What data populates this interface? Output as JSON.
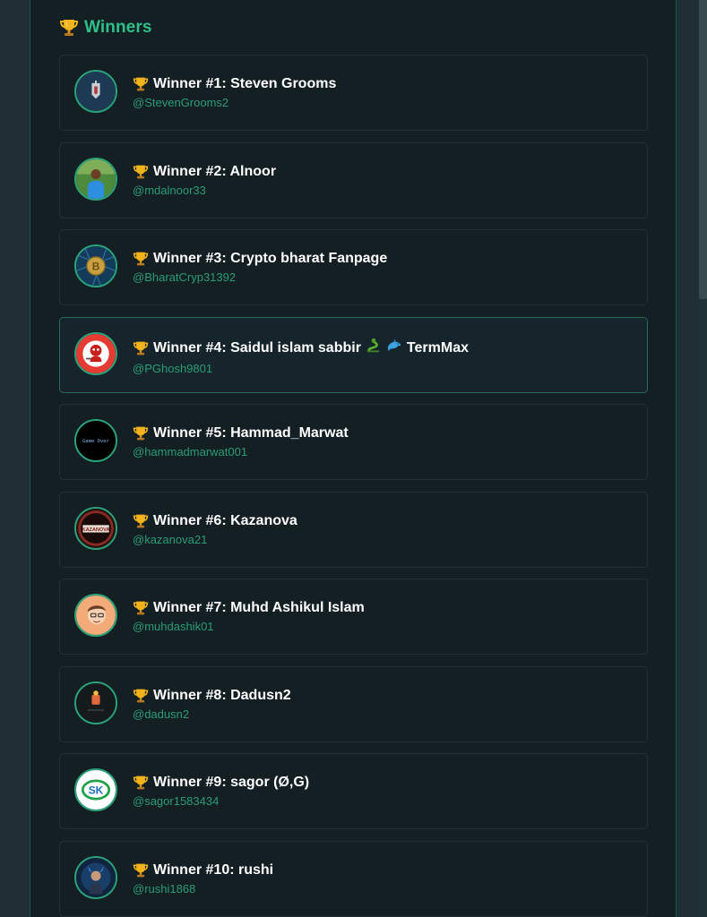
{
  "section": {
    "title": "Winners",
    "icon": "trophy-icon"
  },
  "colors": {
    "accent": "#2fbf88",
    "handle": "#2a9d75",
    "card_bg": "#141f24",
    "card_border": "#223137",
    "highlight_border": "#236b5b"
  },
  "winners": [
    {
      "title": "Winner #1: Steven Grooms",
      "handle": "@StevenGrooms2"
    },
    {
      "title": "Winner #2: Alnoor",
      "handle": "@mdalnoor33"
    },
    {
      "title": "Winner #3: Crypto bharat Fanpage",
      "handle": "@BharatCryp31392"
    },
    {
      "title": "Winner #4: Saidul islam sabbir",
      "title_suffix": "TermMax",
      "handle": "@PGhosh9801",
      "highlighted": true
    },
    {
      "title": "Winner #5: Hammad_Marwat",
      "handle": "@hammadmarwat001",
      "avatar_text": "Game Over"
    },
    {
      "title": "Winner #6: Kazanova",
      "handle": "@kazanova21",
      "avatar_text": "KAZANOVA"
    },
    {
      "title": "Winner #7: Muhd Ashikul Islam",
      "handle": "@muhdashik01"
    },
    {
      "title": "Winner #8: Dadusn2",
      "handle": "@dadusn2"
    },
    {
      "title": "Winner #9: sagor (Ø,G)",
      "handle": "@sagor1583434",
      "avatar_text": "SK"
    },
    {
      "title": "Winner #10: rushi",
      "handle": "@rushi1868"
    }
  ]
}
